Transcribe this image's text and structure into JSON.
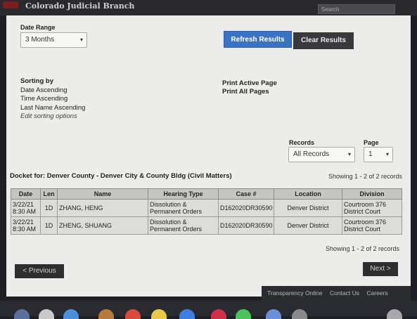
{
  "app": {
    "title": "Colorado Judicial Branch",
    "search_placeholder": "Search"
  },
  "filters": {
    "date_range_label": "Date Range",
    "date_range_value": "3 Months",
    "refresh_label": "Refresh Results",
    "clear_label": "Clear Results"
  },
  "sorting": {
    "title": "Sorting by",
    "lines": [
      "Date Ascending",
      "Time Ascending",
      "Last Name Ascending"
    ],
    "edit_link": "Edit sorting options"
  },
  "print": {
    "active_page": "Print Active Page",
    "all_pages": "Print All Pages"
  },
  "records": {
    "label": "Records",
    "value": "All Records"
  },
  "page": {
    "label": "Page",
    "value": "1"
  },
  "docket": {
    "title": "Docket for: Denver County - Denver City & County Bldg (Civil Matters)",
    "showing": "Showing 1 - 2 of 2 records",
    "columns": [
      "Date",
      "Len",
      "Name",
      "Hearing Type",
      "Case #",
      "Location",
      "Division"
    ],
    "rows": [
      {
        "date1": "3/22/21",
        "date2": "8:30 AM",
        "len": "1D",
        "name": "ZHANG, HENG",
        "hearing1": "Dissolution &",
        "hearing2": "Permanent Orders",
        "case": "D162020DR30590",
        "location": "Denver District",
        "division1": "Courtroom 376",
        "division2": "District Court"
      },
      {
        "date1": "3/22/21",
        "date2": "8:30 AM",
        "len": "1D",
        "name": "ZHENG, SHUANG",
        "hearing1": "Dissolution &",
        "hearing2": "Permanent Orders",
        "case": "D162020DR30590",
        "location": "Denver District",
        "division1": "Courtroom 376",
        "division2": "District Court"
      }
    ]
  },
  "pager": {
    "showing": "Showing 1 - 2 of 2 records",
    "previous": "< Previous",
    "next": "Next >"
  },
  "footer": {
    "links": [
      "Transparency Online",
      "Contact Us",
      "Careers"
    ]
  },
  "taskbar": {
    "icons": [
      "finder-icon",
      "chrome-icon",
      "mail-icon",
      "photos-icon",
      "calendar-icon",
      "notes-icon",
      "app-icon",
      "music-icon",
      "messages-icon",
      "store-icon",
      "settings-icon",
      "trash-icon"
    ]
  }
}
